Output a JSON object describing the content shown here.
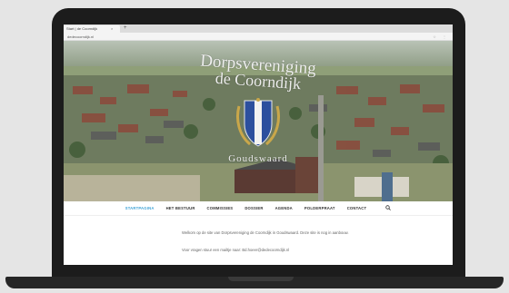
{
  "browser": {
    "tab_title": "Start | de Coorndijk",
    "tab_close": "×",
    "new_tab": "+",
    "url": "dedecoorndijk.nl",
    "address_icons": "☆ ⋮"
  },
  "hero": {
    "title_line1": "Dorpsvereniging",
    "title_line2": "de Coorndijk",
    "subtitle": "Goudswaard"
  },
  "nav": {
    "items": [
      {
        "label": "STARTPAGINA",
        "active": true
      },
      {
        "label": "HET BESTUUR"
      },
      {
        "label": "COMMISSIES"
      },
      {
        "label": "DOSSIER"
      },
      {
        "label": "AGENDA"
      },
      {
        "label": "POLDERPRAAT"
      },
      {
        "label": "CONTACT"
      }
    ],
    "search_icon": "search-icon"
  },
  "content": {
    "paragraph1": "Welkom op de site van Dorpsvereniging de Coorndijk in Goudswaard. Deze site is nog in aanbouw.",
    "paragraph2": "Voor vragen stuur een mailtje naar: Bd.hoeer@dedecoorndijk.nl"
  },
  "colors": {
    "accent": "#3fa3d6",
    "crest_blue": "#2c4f9e",
    "crest_gold": "#c9a74a"
  }
}
